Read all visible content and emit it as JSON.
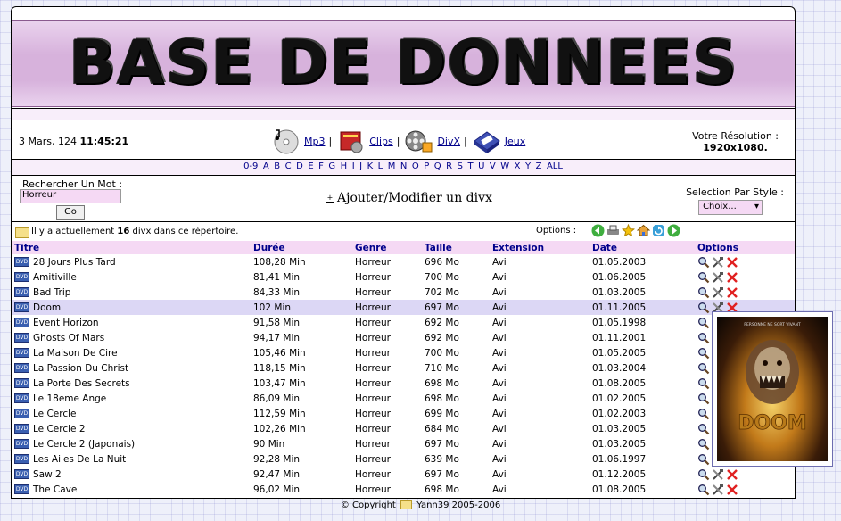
{
  "banner": {
    "title": "BASE DE DONNEES"
  },
  "header": {
    "date": "3 Mars, 124",
    "time": "11:45:21",
    "nav": [
      {
        "label": "Mp3",
        "icon": "cd-icon"
      },
      {
        "label": "Clips",
        "icon": "book-icon"
      },
      {
        "label": "DivX",
        "icon": "film-reel-icon"
      },
      {
        "label": "Jeux",
        "icon": "game-box-icon"
      }
    ],
    "separator": "|",
    "resolution_label": "Votre Résolution :",
    "resolution_value": "1920x1080."
  },
  "alphabet": [
    "0-9",
    "A",
    "B",
    "C",
    "D",
    "E",
    "F",
    "G",
    "H",
    "I",
    "J",
    "K",
    "L",
    "M",
    "N",
    "O",
    "P",
    "Q",
    "R",
    "S",
    "T",
    "U",
    "V",
    "W",
    "X",
    "Y",
    "Z",
    "ALL"
  ],
  "search": {
    "label": "Rechercher Un Mot :",
    "value": "Horreur",
    "go": "Go",
    "add_modify": "Ajouter/Modifier un divx",
    "plus": "+",
    "style_label": "Selection Par Style :",
    "style_value": "Choix..."
  },
  "info": {
    "prefix": "Il y a actuellement",
    "count": "16",
    "suffix": "divx dans ce répertoire.",
    "options_label": "Options :"
  },
  "table": {
    "headers": [
      "Titre",
      "Durée",
      "Genre",
      "Taille",
      "Extension",
      "Date",
      "Options"
    ],
    "rows": [
      {
        "title": "28 Jours Plus Tard",
        "duration": "108,28 Min",
        "genre": "Horreur",
        "size": "696 Mo",
        "ext": "Avi",
        "date": "01.05.2003"
      },
      {
        "title": "Amitiville",
        "duration": "81,41 Min",
        "genre": "Horreur",
        "size": "700 Mo",
        "ext": "Avi",
        "date": "01.06.2005"
      },
      {
        "title": "Bad Trip",
        "duration": "84,33 Min",
        "genre": "Horreur",
        "size": "702 Mo",
        "ext": "Avi",
        "date": "01.03.2005"
      },
      {
        "title": "Doom",
        "duration": "102 Min",
        "genre": "Horreur",
        "size": "697 Mo",
        "ext": "Avi",
        "date": "01.11.2005"
      },
      {
        "title": "Event Horizon",
        "duration": "91,58 Min",
        "genre": "Horreur",
        "size": "692 Mo",
        "ext": "Avi",
        "date": "01.05.1998"
      },
      {
        "title": "Ghosts Of Mars",
        "duration": "94,17 Min",
        "genre": "Horreur",
        "size": "692 Mo",
        "ext": "Avi",
        "date": "01.11.2001"
      },
      {
        "title": "La Maison De Cire",
        "duration": "105,46 Min",
        "genre": "Horreur",
        "size": "700 Mo",
        "ext": "Avi",
        "date": "01.05.2005"
      },
      {
        "title": "La Passion Du Christ",
        "duration": "118,15 Min",
        "genre": "Horreur",
        "size": "710 Mo",
        "ext": "Avi",
        "date": "01.03.2004"
      },
      {
        "title": "La Porte Des Secrets",
        "duration": "103,47 Min",
        "genre": "Horreur",
        "size": "698 Mo",
        "ext": "Avi",
        "date": "01.08.2005"
      },
      {
        "title": "Le 18eme Ange",
        "duration": "86,09 Min",
        "genre": "Horreur",
        "size": "698 Mo",
        "ext": "Avi",
        "date": "01.02.2005"
      },
      {
        "title": "Le Cercle",
        "duration": "112,59 Min",
        "genre": "Horreur",
        "size": "699 Mo",
        "ext": "Avi",
        "date": "01.02.2003"
      },
      {
        "title": "Le Cercle 2",
        "duration": "102,26 Min",
        "genre": "Horreur",
        "size": "684 Mo",
        "ext": "Avi",
        "date": "01.03.2005"
      },
      {
        "title": "Le Cercle 2 (Japonais)",
        "duration": "90 Min",
        "genre": "Horreur",
        "size": "697 Mo",
        "ext": "Avi",
        "date": "01.03.2005"
      },
      {
        "title": "Les Ailes De La Nuit",
        "duration": "92,28 Min",
        "genre": "Horreur",
        "size": "639 Mo",
        "ext": "Avi",
        "date": "01.06.1997"
      },
      {
        "title": "Saw 2",
        "duration": "92,47 Min",
        "genre": "Horreur",
        "size": "697 Mo",
        "ext": "Avi",
        "date": "01.12.2005"
      },
      {
        "title": "The Cave",
        "duration": "96,02 Min",
        "genre": "Horreur",
        "size": "698 Mo",
        "ext": "Avi",
        "date": "01.08.2005"
      }
    ],
    "highlighted_row": 3,
    "row_icon": "dvd-icon",
    "row_icon_text": "DVD",
    "option_icons": [
      "magnifier-icon",
      "tools-icon",
      "delete-x-icon"
    ]
  },
  "poster": {
    "subject": "Doom",
    "tagline": "PERSONNE NE SORT VIVANT",
    "title_text": "DOOM"
  },
  "footer": {
    "text": "© Copyright",
    "author": "Yann39 2005-2006"
  },
  "colors": {
    "banner": "#d7b2dc",
    "header_row": "#f5d9f4",
    "highlight": "#dcd7f5",
    "link": "#00008b",
    "delete": "#e02020"
  }
}
